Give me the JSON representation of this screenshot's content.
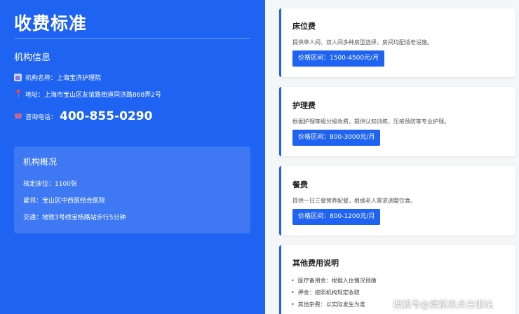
{
  "left": {
    "title": "收费标准",
    "section_title": "机构信息",
    "name": "机构名称：上海宝济护理院",
    "address": "地址：上海市宝山区友谊路街道同济路868弄2号",
    "phone_label": "咨询电话：",
    "phone": "400-855-0290",
    "overview": {
      "title": "机构概况",
      "beds": "核定床位：1100张",
      "neighbor": "紧邻：宝山区中西医结合医院",
      "traffic": "交通：地铁3号线宝杨路站步行5分钟"
    }
  },
  "cards": [
    {
      "title": "床位费",
      "desc": "提供单人间、双人间多种房型选择，房间均配适老设施。",
      "price": "价格区间：1500-4500元/月"
    },
    {
      "title": "护理费",
      "desc": "根据护理等级分级收费，提供认知训练、压疮预防等专业护理。",
      "price": "价格区间：800-3000元/月"
    },
    {
      "title": "餐费",
      "desc": "提供一日三餐营养配餐，根据老人需求调整饮食。",
      "price": "价格区间：800-1200元/月"
    }
  ],
  "notes": {
    "title": "其他费用说明",
    "items": [
      "医疗备用金：根据入住情况预缴",
      "押金：按照机构规定收取",
      "其他杂费：以实际发生为准"
    ]
  },
  "watermark": "搜狐号@搜狐焦点白银站",
  "colors": {
    "accent": "#1f63f2"
  },
  "icons": {
    "name": "building-icon",
    "address": "location-pin-icon",
    "phone": "phone-icon"
  }
}
